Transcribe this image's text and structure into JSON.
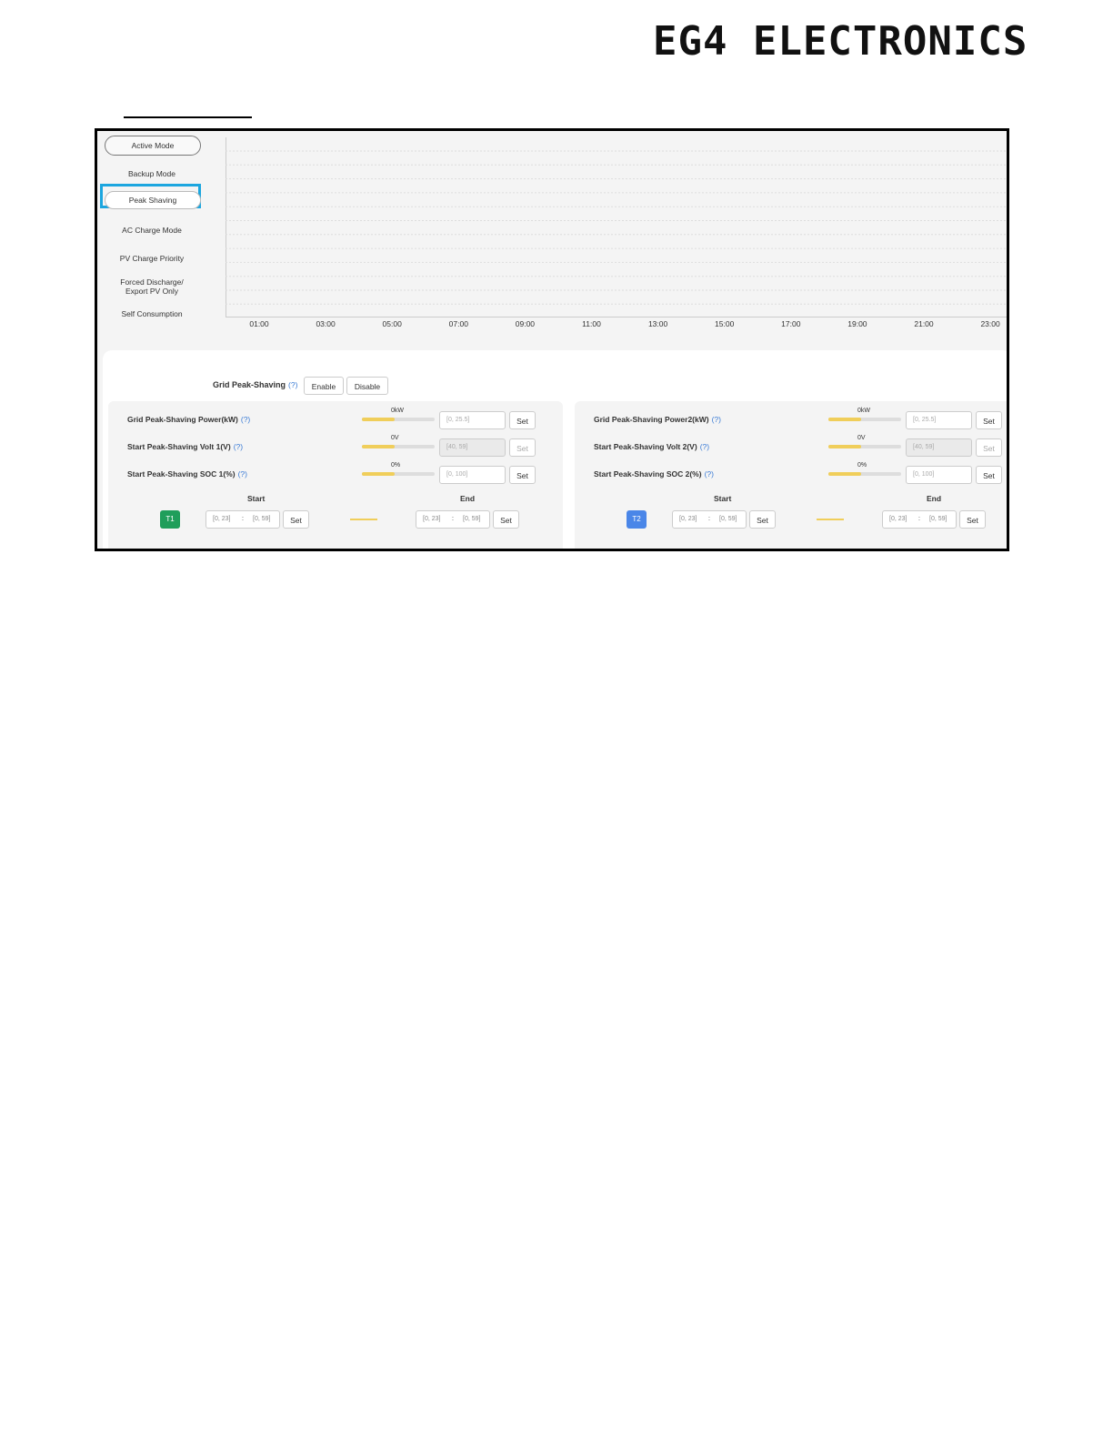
{
  "brand": {
    "logo_text": "EG4 ELECTRONICS"
  },
  "modes": {
    "items": [
      {
        "label": "Active Mode"
      },
      {
        "label": "Backup Mode"
      },
      {
        "label": "Peak Shaving"
      },
      {
        "label": "AC Charge Mode"
      },
      {
        "label": "PV Charge Priority"
      },
      {
        "label": "Forced Discharge/\nExport PV Only"
      },
      {
        "label": "Self Consumption"
      }
    ],
    "selected": "Peak Shaving"
  },
  "timeline": {
    "ticks": [
      "01:00",
      "03:00",
      "05:00",
      "07:00",
      "09:00",
      "11:00",
      "13:00",
      "15:00",
      "17:00",
      "19:00",
      "21:00",
      "23:00"
    ]
  },
  "grid_peak_shaving": {
    "label": "Grid Peak-Shaving",
    "help": "(?)",
    "enable_label": "Enable",
    "disable_label": "Disable"
  },
  "cards": [
    {
      "rows": [
        {
          "label": "Grid Peak-Shaving Power(kW)",
          "help": "(?)",
          "value": "0kW",
          "fill": 0.45,
          "placeholder": "[0, 25.5]",
          "disabled": false,
          "set": "Set"
        },
        {
          "label": "Start Peak-Shaving Volt 1(V)",
          "help": "(?)",
          "value": "0V",
          "fill": 0.45,
          "placeholder": "[40, 59]",
          "disabled": true,
          "set": "Set"
        },
        {
          "label": "Start Peak-Shaving SOC 1(%)",
          "help": "(?)",
          "value": "0%",
          "fill": 0.45,
          "placeholder": "[0, 100]",
          "disabled": false,
          "set": "Set"
        }
      ],
      "start_label": "Start",
      "end_label": "End",
      "badge": "T1",
      "badge_color": "#1f9e5a",
      "start_hour": "[0, 23]",
      "start_min": "[0, 59]",
      "start_set": "Set",
      "end_hour": "[0, 23]",
      "end_min": "[0, 59]",
      "end_set": "Set",
      "colon": ":"
    },
    {
      "rows": [
        {
          "label": "Grid Peak-Shaving Power2(kW)",
          "help": "(?)",
          "value": "0kW",
          "fill": 0.45,
          "placeholder": "[0, 25.5]",
          "disabled": false,
          "set": "Set"
        },
        {
          "label": "Start Peak-Shaving Volt 2(V)",
          "help": "(?)",
          "value": "0V",
          "fill": 0.45,
          "placeholder": "[40, 59]",
          "disabled": true,
          "set": "Set"
        },
        {
          "label": "Start Peak-Shaving SOC 2(%)",
          "help": "(?)",
          "value": "0%",
          "fill": 0.45,
          "placeholder": "[0, 100]",
          "disabled": false,
          "set": "Set"
        }
      ],
      "start_label": "Start",
      "end_label": "End",
      "badge": "T2",
      "badge_color": "#4a86e8",
      "start_hour": "[0, 23]",
      "start_min": "[0, 59]",
      "start_set": "Set",
      "end_hour": "[0, 23]",
      "end_min": "[0, 59]",
      "end_set": "Set",
      "colon": ":"
    }
  ]
}
